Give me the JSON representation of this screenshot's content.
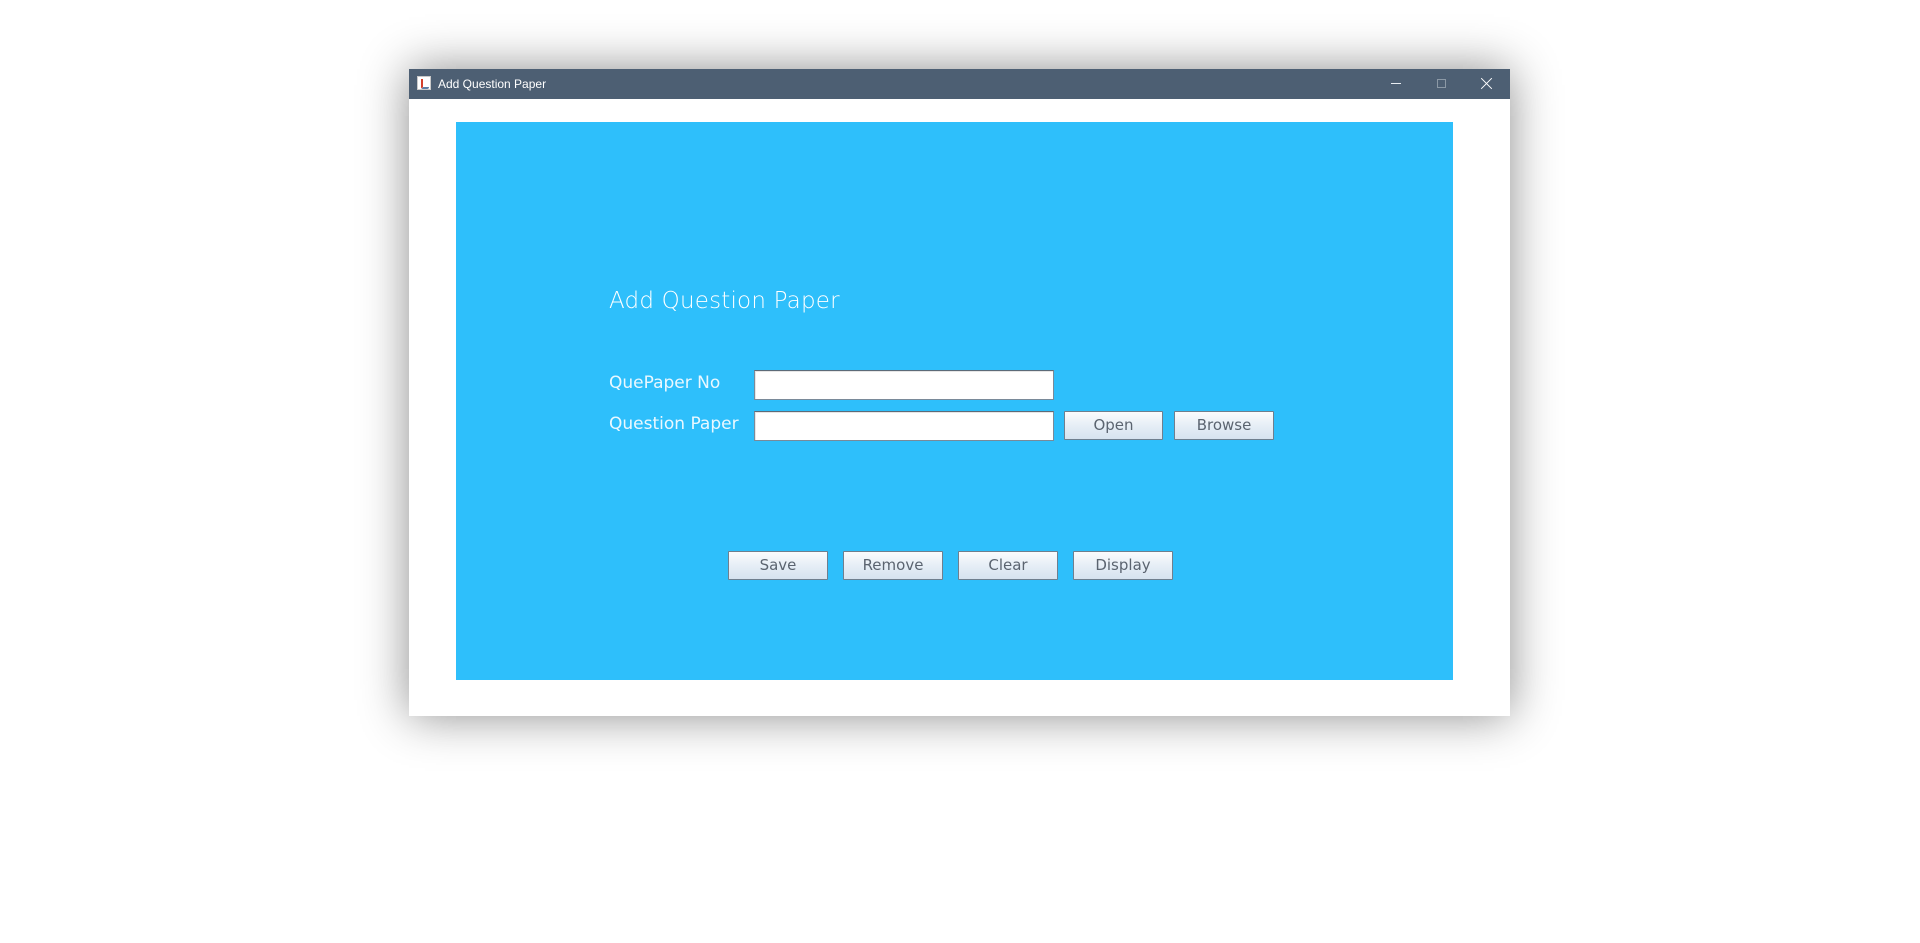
{
  "window": {
    "title": "Add Question Paper",
    "icon": "java-cup-icon",
    "controls": {
      "minimize_icon": "minimize-icon",
      "maximize_icon": "maximize-icon",
      "close_icon": "close-icon"
    }
  },
  "form": {
    "heading": "Add Question Paper",
    "quepaper_no": {
      "label": "QuePaper No",
      "value": ""
    },
    "question_paper": {
      "label": "Question Paper",
      "value": ""
    },
    "buttons": {
      "open": "Open",
      "browse": "Browse",
      "save": "Save",
      "remove": "Remove",
      "clear": "Clear",
      "display": "Display"
    }
  },
  "colors": {
    "titlebar": "#4d5f73",
    "panel": "#2ebffb",
    "text": "#ffffff"
  }
}
